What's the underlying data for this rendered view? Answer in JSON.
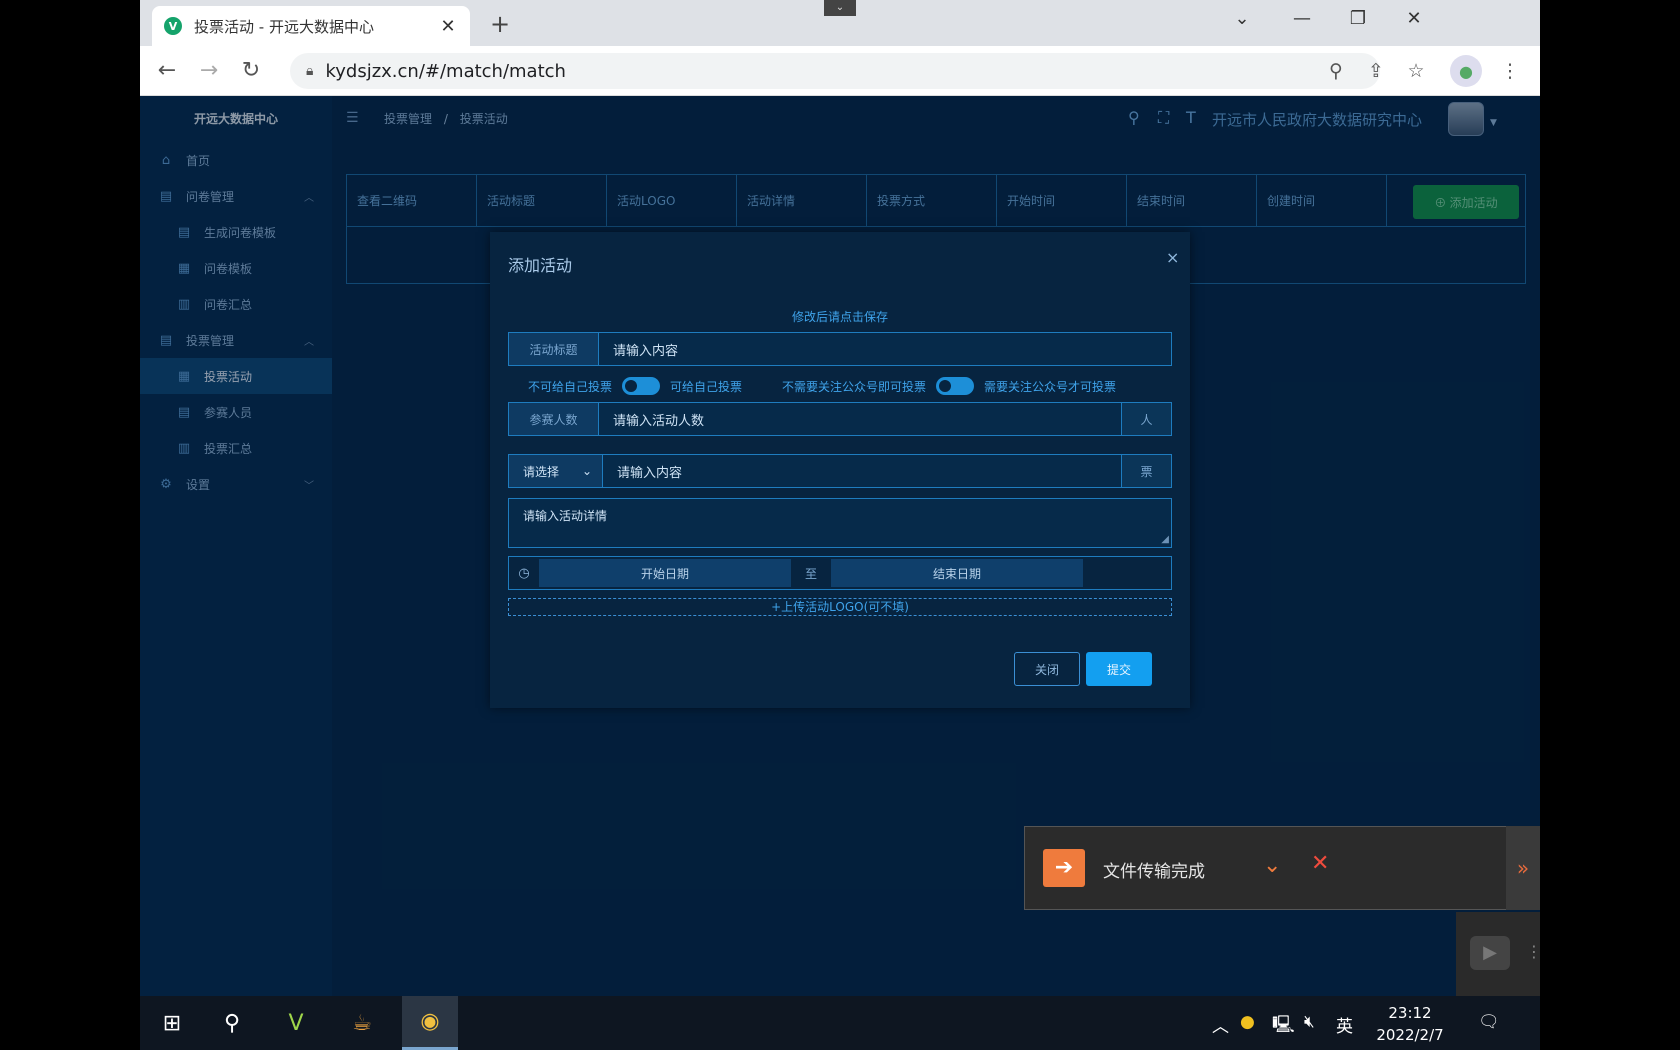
{
  "browser": {
    "tab_title": "投票活动 - 开远大数据中心",
    "tab_close": "✕",
    "new_tab": "+",
    "url": "kydsjzx.cn/#/match/match"
  },
  "sidebar": {
    "brand": "开远大数据中心",
    "items": [
      {
        "label": "首页",
        "icon": "home-icon"
      },
      {
        "label": "问卷管理",
        "icon": "document-icon"
      },
      {
        "label": "生成问卷模板",
        "icon": "document-icon"
      },
      {
        "label": "问卷模板",
        "icon": "grid-icon"
      },
      {
        "label": "问卷汇总",
        "icon": "chart-icon"
      },
      {
        "label": "投票管理",
        "icon": "document-icon"
      },
      {
        "label": "投票活动",
        "icon": "grid-icon"
      },
      {
        "label": "参赛人员",
        "icon": "document-icon"
      },
      {
        "label": "投票汇总",
        "icon": "chart-icon"
      },
      {
        "label": "设置",
        "icon": "gear-icon"
      }
    ]
  },
  "topbar": {
    "breadcrumb_parent": "投票管理",
    "breadcrumb_sep": "/",
    "breadcrumb_current": "投票活动",
    "org_name": "开远市人民政府大数据研究中心"
  },
  "table": {
    "columns": [
      "查看二维码",
      "活动标题",
      "活动LOGO",
      "活动详情",
      "投票方式",
      "开始时间",
      "结束时间",
      "创建时间"
    ],
    "add_button": "⊕ 添加活动"
  },
  "modal": {
    "title": "添加活动",
    "close": "×",
    "hint": "修改后请点击保存",
    "title_label": "活动标题",
    "title_placeholder": "请输入内容",
    "toggle1_off": "不可给自己投票",
    "toggle1_on": "可给自己投票",
    "toggle2_off": "不需要关注公众号即可投票",
    "toggle2_on": "需要关注公众号才可投票",
    "participants_label": "参赛人数",
    "participants_placeholder": "请输入活动人数",
    "participants_unit": "人",
    "select_label": "请选择",
    "vote_placeholder": "请输入内容",
    "vote_unit": "票",
    "detail_placeholder": "请输入活动详情",
    "start_date": "开始日期",
    "date_sep": "至",
    "end_date": "结束日期",
    "upload": "+上传活动LOGO(可不填)",
    "btn_close": "关闭",
    "btn_submit": "提交"
  },
  "notification": {
    "text": "文件传输完成"
  },
  "taskbar": {
    "ime": "英",
    "time": "23:12",
    "date": "2022/2/7"
  }
}
